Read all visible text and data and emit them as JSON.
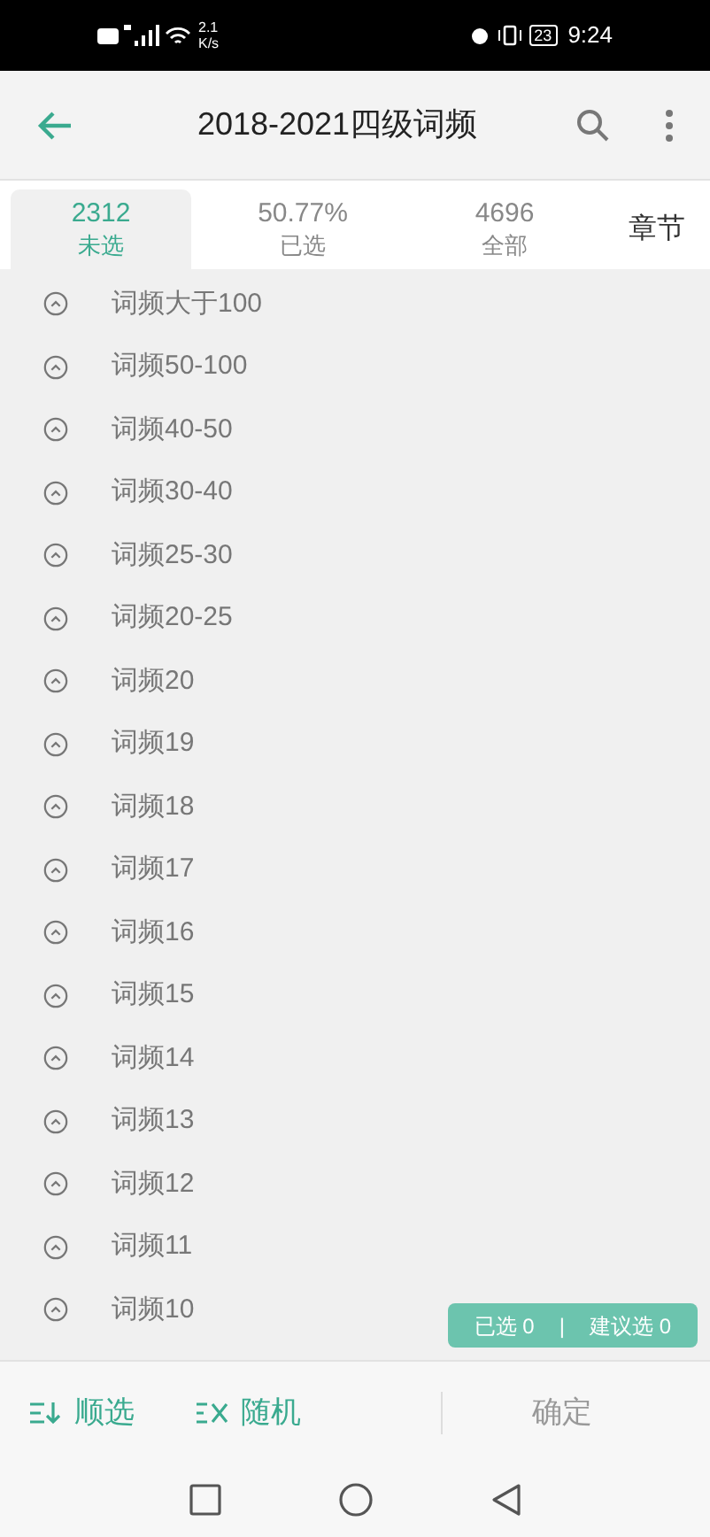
{
  "status_bar": {
    "speed_value": "2.1",
    "speed_unit": "K/s",
    "battery": "23",
    "time": "9:24"
  },
  "header": {
    "title": "2018-2021四级词频"
  },
  "tabs": [
    {
      "value": "2312",
      "label": "未选",
      "selected": true
    },
    {
      "value": "50.77%",
      "label": "已选",
      "selected": false
    },
    {
      "value": "4696",
      "label": "全部",
      "selected": false
    }
  ],
  "chapter_button": "章节",
  "groups": [
    {
      "label": "词频大于100",
      "expanded": false
    },
    {
      "label": "词频50-100",
      "expanded": false
    },
    {
      "label": "词频40-50",
      "expanded": false
    },
    {
      "label": "词频30-40",
      "expanded": false
    },
    {
      "label": "词频25-30",
      "expanded": false
    },
    {
      "label": "词频20-25",
      "expanded": false
    },
    {
      "label": "词频20",
      "expanded": false
    },
    {
      "label": "词频19",
      "expanded": false
    },
    {
      "label": "词频18",
      "expanded": false
    },
    {
      "label": "词频17",
      "expanded": false
    },
    {
      "label": "词频16",
      "expanded": false
    },
    {
      "label": "词频15",
      "expanded": false
    },
    {
      "label": "词频14",
      "expanded": false
    },
    {
      "label": "词频13",
      "expanded": false
    },
    {
      "label": "词频12",
      "expanded": false
    },
    {
      "label": "词频11",
      "expanded": false
    },
    {
      "label": "词频10",
      "expanded": false
    }
  ],
  "selection_badge": {
    "selected": "已选 0",
    "divider": "|",
    "suggested": "建议选 0"
  },
  "bottom_bar": {
    "sequential": "顺选",
    "random": "随机",
    "confirm": "确定"
  }
}
